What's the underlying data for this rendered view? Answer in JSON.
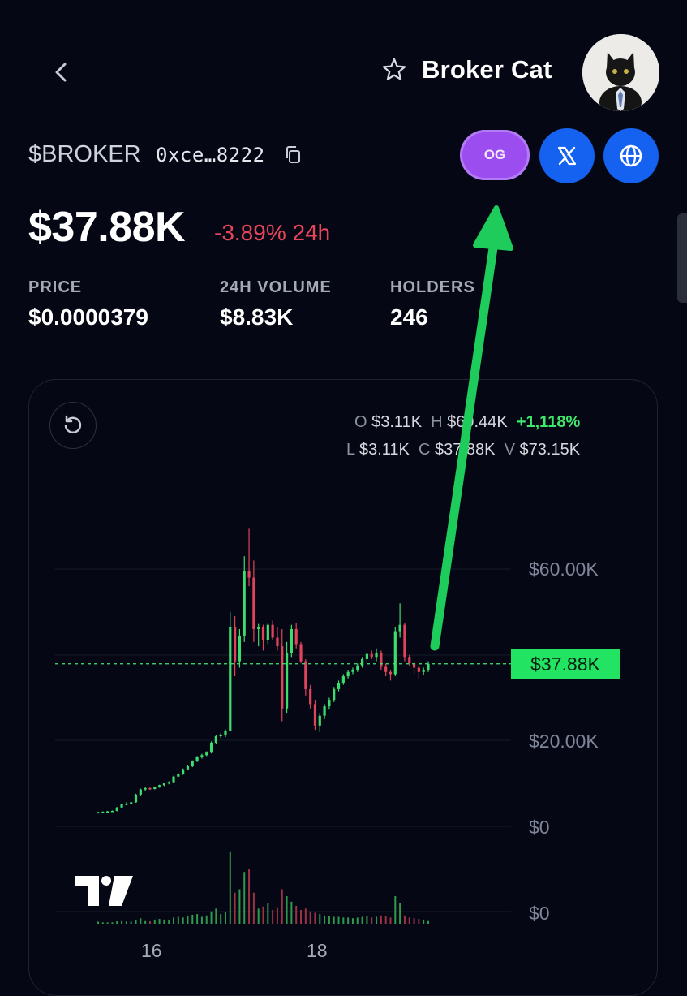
{
  "header": {
    "title": "Broker Cat",
    "icons": [
      "back-chevron-icon",
      "star-icon"
    ]
  },
  "token": {
    "ticker": "$BROKER",
    "address": "0xce…8222",
    "badge": "OG",
    "links": [
      "x-logo-icon",
      "globe-icon"
    ]
  },
  "market": {
    "market_cap": "$37.88K",
    "change": "-3.89% 24h"
  },
  "stats": [
    {
      "label": "PRICE",
      "value": "$0.0000379"
    },
    {
      "label": "24H VOLUME",
      "value": "$8.83K"
    },
    {
      "label": "HOLDERS",
      "value": "246"
    }
  ],
  "ohlc": {
    "o_key": "O",
    "o_val": "$3.11K",
    "h_key": "H",
    "h_val": "$69.44K",
    "pct": "+1,118%",
    "l_key": "L",
    "l_val": "$3.11K",
    "c_key": "C",
    "c_val": "$37.88K",
    "v_key": "V",
    "v_val": "$73.15K"
  },
  "chart_data": {
    "type": "candlestick",
    "y_ticks": [
      "$60.00K",
      "$20.00K",
      "$0"
    ],
    "volume_tick": "$0",
    "x_ticks": [
      "16",
      "18"
    ],
    "current_price_label": "$37.88K",
    "ylim": [
      0,
      70000
    ],
    "colors": {
      "up": "#3ddc6e",
      "down": "#e0435c",
      "price_line": "#43e36c"
    },
    "candles": [
      [
        3100,
        3400,
        3000,
        3300
      ],
      [
        3300,
        3500,
        3200,
        3400
      ],
      [
        3400,
        3600,
        3300,
        3500
      ],
      [
        3500,
        3700,
        3400,
        3600
      ],
      [
        3600,
        4500,
        3500,
        4400
      ],
      [
        4400,
        5200,
        4300,
        5100
      ],
      [
        5100,
        5600,
        4900,
        5300
      ],
      [
        5300,
        5700,
        5100,
        5600
      ],
      [
        5600,
        7600,
        5500,
        7400
      ],
      [
        7400,
        8800,
        7200,
        8600
      ],
      [
        8600,
        9200,
        8300,
        8900
      ],
      [
        8900,
        9100,
        8500,
        8700
      ],
      [
        8700,
        9300,
        8600,
        9200
      ],
      [
        9200,
        9700,
        9000,
        9600
      ],
      [
        9600,
        10100,
        9400,
        10000
      ],
      [
        10000,
        10500,
        9800,
        10300
      ],
      [
        10300,
        11800,
        10200,
        11600
      ],
      [
        11600,
        12400,
        11500,
        12200
      ],
      [
        12200,
        13500,
        12000,
        13300
      ],
      [
        13300,
        14200,
        13100,
        14000
      ],
      [
        14000,
        15400,
        13800,
        15200
      ],
      [
        15200,
        16400,
        15000,
        16200
      ],
      [
        16200,
        16900,
        15800,
        16600
      ],
      [
        16600,
        17500,
        16400,
        17200
      ],
      [
        17200,
        19800,
        17000,
        19500
      ],
      [
        19500,
        21200,
        19300,
        21000
      ],
      [
        21000,
        21700,
        20600,
        21400
      ],
      [
        21400,
        22600,
        20800,
        22300
      ],
      [
        22300,
        50000,
        22200,
        46500
      ],
      [
        46500,
        49000,
        35000,
        38500
      ],
      [
        38500,
        46000,
        37000,
        44500
      ],
      [
        44500,
        63000,
        43000,
        59500
      ],
      [
        59500,
        69400,
        56000,
        58000
      ],
      [
        58000,
        62000,
        43000,
        46000
      ],
      [
        46000,
        47200,
        42000,
        46500
      ],
      [
        46500,
        47000,
        41000,
        43500
      ],
      [
        43500,
        47500,
        42500,
        47000
      ],
      [
        47000,
        48000,
        43500,
        44000
      ],
      [
        44000,
        46500,
        41000,
        42000
      ],
      [
        42000,
        46000,
        24500,
        27500
      ],
      [
        27500,
        43000,
        26500,
        40500
      ],
      [
        40500,
        47000,
        39500,
        46000
      ],
      [
        46000,
        47500,
        41500,
        42500
      ],
      [
        42500,
        43000,
        38000,
        38500
      ],
      [
        38500,
        39000,
        30500,
        32000
      ],
      [
        32000,
        33000,
        27500,
        28500
      ],
      [
        28500,
        29500,
        22500,
        23500
      ],
      [
        23500,
        26500,
        22000,
        25800
      ],
      [
        25800,
        28500,
        25000,
        28000
      ],
      [
        28000,
        30000,
        27200,
        29500
      ],
      [
        29500,
        32500,
        29000,
        32000
      ],
      [
        32000,
        34000,
        31500,
        33500
      ],
      [
        33500,
        35500,
        33000,
        35000
      ],
      [
        35000,
        36500,
        34500,
        36000
      ],
      [
        36000,
        37000,
        35500,
        36500
      ],
      [
        36500,
        38000,
        36000,
        37500
      ],
      [
        37500,
        39500,
        37000,
        39000
      ],
      [
        39000,
        40500,
        38500,
        40200
      ],
      [
        40200,
        41000,
        39000,
        39500
      ],
      [
        39500,
        41500,
        38500,
        40500
      ],
      [
        40500,
        41000,
        36500,
        37200
      ],
      [
        37200,
        38000,
        35000,
        36000
      ],
      [
        36000,
        36500,
        34000,
        35500
      ],
      [
        35500,
        46500,
        35000,
        45500
      ],
      [
        45500,
        52000,
        44000,
        47000
      ],
      [
        47000,
        47500,
        38500,
        39500
      ],
      [
        39500,
        40000,
        37500,
        38000
      ],
      [
        38000,
        38500,
        35500,
        37000
      ],
      [
        37000,
        37500,
        34500,
        36000
      ],
      [
        36000,
        37000,
        35200,
        36500
      ],
      [
        36500,
        38500,
        36000,
        37900
      ]
    ],
    "volumes": [
      0.3,
      0.2,
      0.2,
      0.2,
      0.4,
      0.5,
      0.3,
      0.3,
      0.6,
      0.8,
      0.5,
      0.4,
      0.6,
      0.7,
      0.6,
      0.6,
      0.9,
      1.0,
      0.9,
      1.1,
      1.3,
      1.4,
      1.0,
      1.2,
      1.8,
      2.2,
      1.4,
      1.7,
      10.5,
      4.5,
      5.0,
      7.5,
      8.0,
      4.5,
      2.2,
      2.5,
      3.0,
      2.0,
      2.4,
      5.0,
      4.0,
      3.2,
      2.6,
      2.0,
      2.2,
      1.8,
      1.6,
      1.4,
      1.2,
      1.1,
      1.0,
      1.0,
      0.9,
      0.9,
      0.8,
      0.9,
      1.0,
      1.1,
      0.9,
      1.0,
      1.2,
      1.1,
      0.9,
      4.0,
      3.0,
      1.2,
      0.9,
      0.8,
      0.7,
      0.6,
      0.5
    ]
  }
}
